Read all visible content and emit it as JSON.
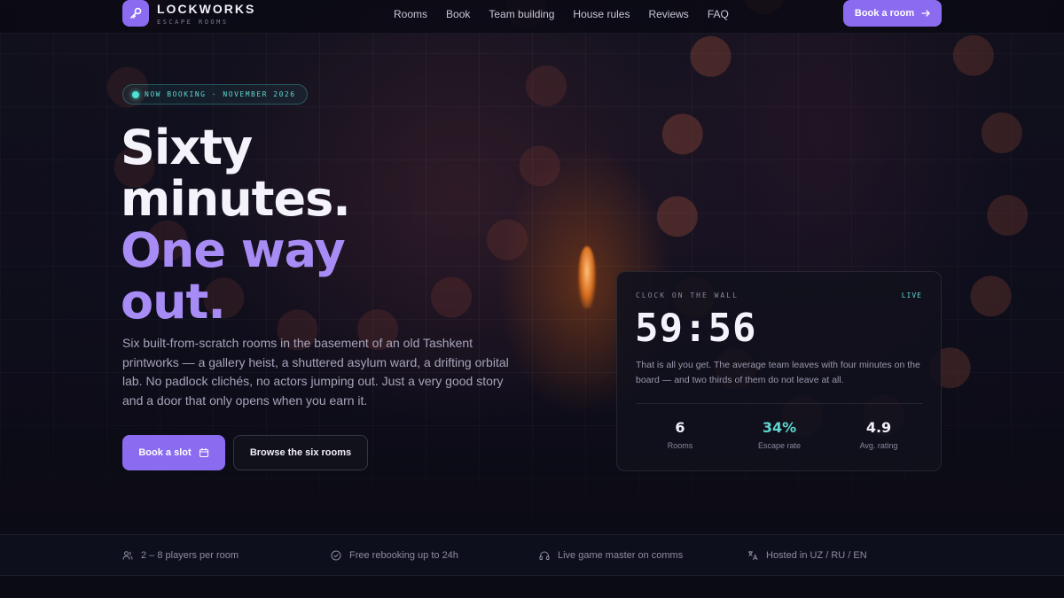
{
  "brand": {
    "name": "LOCKWORKS",
    "tagline": "ESCAPE ROOMS",
    "logo_icon": "key-icon",
    "accent": "#8b6cf0"
  },
  "nav": {
    "links": [
      "Rooms",
      "Book",
      "Team building",
      "House rules",
      "Reviews",
      "FAQ"
    ],
    "cta_label": "Book a room"
  },
  "hero": {
    "badge": "NOW BOOKING · NOVEMBER 2026",
    "headline": [
      "Sixty",
      "minutes.",
      "One way",
      "out."
    ],
    "lede": "Six built-from-scratch rooms in the basement of an old Tashkent printworks — a gallery heist, a shuttered asylum ward, a drifting orbital lab. No padlock clichés, no actors jumping out. Just a very good story and a door that only opens when you earn it.",
    "primary_button": "Book a slot",
    "secondary_button": "Browse the six rooms"
  },
  "clock_card": {
    "label": "CLOCK ON THE WALL",
    "status": "LIVE",
    "time": "59:56",
    "description": "That is all you get. The average team leaves with four minutes on the board — and two thirds of them do not leave at all.",
    "stats": [
      {
        "value": "6",
        "label": "Rooms"
      },
      {
        "value": "34%",
        "label": "Escape rate"
      },
      {
        "value": "4.9",
        "label": "Avg. rating"
      }
    ],
    "accent_color": "#5fd6d0"
  },
  "features": [
    {
      "icon": "users-icon",
      "text": "2 – 8 players per room"
    },
    {
      "icon": "check-circle-icon",
      "text": "Free rebooking up to 24h"
    },
    {
      "icon": "headphones-icon",
      "text": "Live game master on comms"
    },
    {
      "icon": "translate-icon",
      "text": "Hosted in UZ / RU / EN"
    }
  ]
}
